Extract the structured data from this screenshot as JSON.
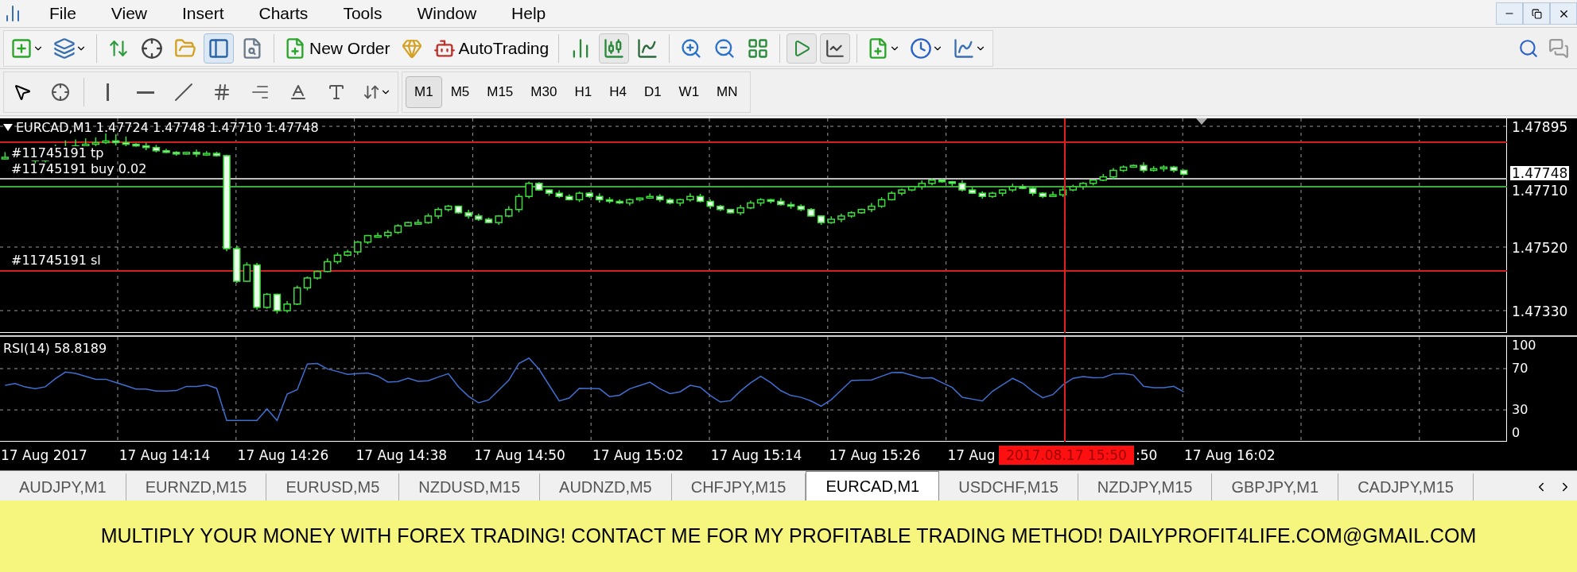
{
  "menu": [
    "File",
    "View",
    "Insert",
    "Charts",
    "Tools",
    "Window",
    "Help"
  ],
  "toolbar": {
    "new_order": "New Order",
    "autotrading": "AutoTrading"
  },
  "timeframes": [
    {
      "label": "M1",
      "selected": true
    },
    {
      "label": "M5",
      "selected": false
    },
    {
      "label": "M15",
      "selected": false
    },
    {
      "label": "M30",
      "selected": false
    },
    {
      "label": "H1",
      "selected": false
    },
    {
      "label": "H4",
      "selected": false
    },
    {
      "label": "D1",
      "selected": false
    },
    {
      "label": "W1",
      "selected": false
    },
    {
      "label": "MN",
      "selected": false
    }
  ],
  "chart": {
    "header": "EURCAD,M1 1.47724 1.47748 1.47710 1.47748",
    "order_labels": [
      "#11745191 tp",
      "#11745191 buy 0.02",
      "#11745191 sl"
    ],
    "price_ticks": [
      "1.47895",
      "1.47710",
      "1.47520",
      "1.47330"
    ],
    "bid_label": "1.47748",
    "indicator": "RSI(14) 58.8189",
    "indicator_ticks": [
      "100",
      "70",
      "30",
      "0"
    ],
    "time_labels": [
      "17 Aug 2017",
      "17 Aug 14:14",
      "17 Aug 14:26",
      "17 Aug 14:38",
      "17 Aug 14:50",
      "17 Aug 15:02",
      "17 Aug 15:14",
      "17 Aug 15:26",
      "17 Aug",
      ":50",
      "17 Aug 16:02"
    ],
    "cursor_time": "2017.08.17 15:50"
  },
  "tabs": [
    {
      "label": "AUDJPY,M1",
      "selected": false
    },
    {
      "label": "EURNZD,M15",
      "selected": false
    },
    {
      "label": "EURUSD,M5",
      "selected": false
    },
    {
      "label": "NZDUSD,M15",
      "selected": false
    },
    {
      "label": "AUDNZD,M5",
      "selected": false
    },
    {
      "label": "CHFJPY,M15",
      "selected": false
    },
    {
      "label": "EURCAD,M1",
      "selected": true
    },
    {
      "label": "USDCHF,M15",
      "selected": false
    },
    {
      "label": "NZDJPY,M15",
      "selected": false
    },
    {
      "label": "GBPJPY,M1",
      "selected": false
    },
    {
      "label": "CADJPY,M15",
      "selected": false
    }
  ],
  "banner": "MULTIPLY YOUR MONEY WITH FOREX TRADING! CONTACT ME FOR MY PROFITABLE TRADING METHOD! DAILYPROFIT4LIFE.COM@GMAIL.COM"
}
